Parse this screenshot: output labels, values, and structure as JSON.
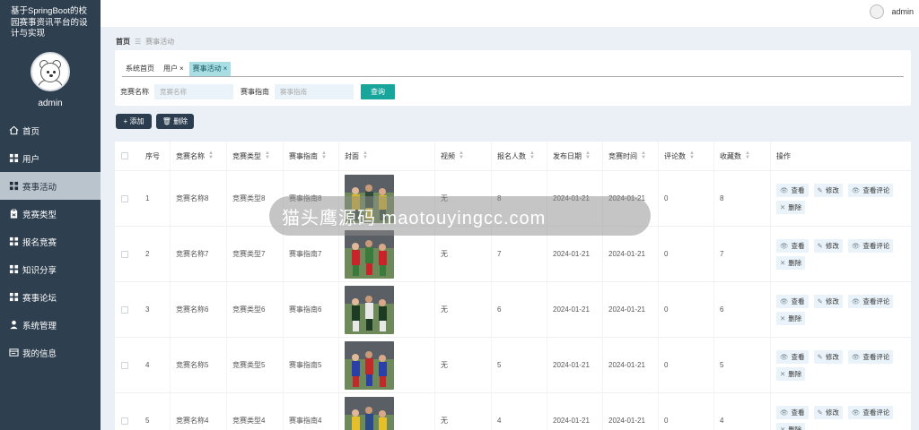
{
  "sidebar": {
    "title": "基于SpringBoot的校园赛事资讯平台的设计与实现",
    "user_name": "admin",
    "items": [
      {
        "label": "首页",
        "icon": "home-icon"
      },
      {
        "label": "用户",
        "icon": "grid-icon"
      },
      {
        "label": "赛事活动",
        "icon": "grid-icon",
        "active": true
      },
      {
        "label": "竞赛类型",
        "icon": "clipboard-icon"
      },
      {
        "label": "报名竞赛",
        "icon": "grid-icon"
      },
      {
        "label": "知识分享",
        "icon": "grid-icon"
      },
      {
        "label": "赛事论坛",
        "icon": "grid-icon"
      },
      {
        "label": "系统管理",
        "icon": "person-icon"
      },
      {
        "label": "我的信息",
        "icon": "id-card-icon"
      }
    ]
  },
  "topbar": {
    "user_name": "admin"
  },
  "breadcrumb": {
    "home": "首页",
    "current": "赛事活动"
  },
  "tabs": [
    {
      "label": "系统首页",
      "closable": false
    },
    {
      "label": "用户",
      "closable": true
    },
    {
      "label": "赛事活动",
      "closable": true,
      "active": true
    }
  ],
  "search": {
    "name_label": "竞赛名称",
    "name_placeholder": "竞赛名称",
    "guide_label": "赛事指南",
    "guide_placeholder": "赛事指南",
    "button": "查询"
  },
  "actions": {
    "add": "+ 添加",
    "delete": "删除"
  },
  "table": {
    "headers": {
      "no": "序号",
      "name": "竞赛名称",
      "type": "竞赛类型",
      "guide": "赛事指南",
      "cover": "封面",
      "video": "视频",
      "signup": "报名人数",
      "pub": "发布日期",
      "time": "竞赛时间",
      "comment": "评论数",
      "fav": "收藏数",
      "ops": "操作"
    },
    "ops": {
      "view": "查看",
      "edit": "修改",
      "view_comment": "查看评论",
      "delete": "删除"
    },
    "rows": [
      {
        "no": "1",
        "name": "竞赛名称8",
        "type": "竞赛类型8",
        "guide": "赛事指南8",
        "video": "无",
        "signup": "8",
        "pub": "2024-01-21",
        "time": "2024-01-21",
        "comment": "0",
        "fav": "8",
        "cover_colors": [
          "#d8b62a",
          "#2f4a3a"
        ]
      },
      {
        "no": "2",
        "name": "竞赛名称7",
        "type": "竞赛类型7",
        "guide": "赛事指南7",
        "video": "无",
        "signup": "7",
        "pub": "2024-01-21",
        "time": "2024-01-21",
        "comment": "0",
        "fav": "7",
        "cover_colors": [
          "#c8242a",
          "#3a7a3a"
        ]
      },
      {
        "no": "3",
        "name": "竞赛名称6",
        "type": "竞赛类型6",
        "guide": "赛事指南6",
        "video": "无",
        "signup": "6",
        "pub": "2024-01-21",
        "time": "2024-01-21",
        "comment": "0",
        "fav": "6",
        "cover_colors": [
          "#1d3a22",
          "#e8e8e8"
        ]
      },
      {
        "no": "4",
        "name": "竞赛名称5",
        "type": "竞赛类型5",
        "guide": "赛事指南5",
        "video": "无",
        "signup": "5",
        "pub": "2024-01-21",
        "time": "2024-01-21",
        "comment": "0",
        "fav": "5",
        "cover_colors": [
          "#2a3fa8",
          "#c22a2a"
        ]
      },
      {
        "no": "5",
        "name": "竞赛名称4",
        "type": "竞赛类型4",
        "guide": "赛事指南4",
        "video": "无",
        "signup": "4",
        "pub": "2024-01-21",
        "time": "2024-01-21",
        "comment": "0",
        "fav": "4",
        "cover_colors": [
          "#e6c02a",
          "#2a4a8a"
        ]
      }
    ]
  },
  "watermark": {
    "text": "猫头鹰源码 maotouyingcc.com"
  },
  "colors": {
    "sidebar": "#2e3f4f",
    "accent": "#18a69c",
    "active_tab": "#a8dee4"
  }
}
